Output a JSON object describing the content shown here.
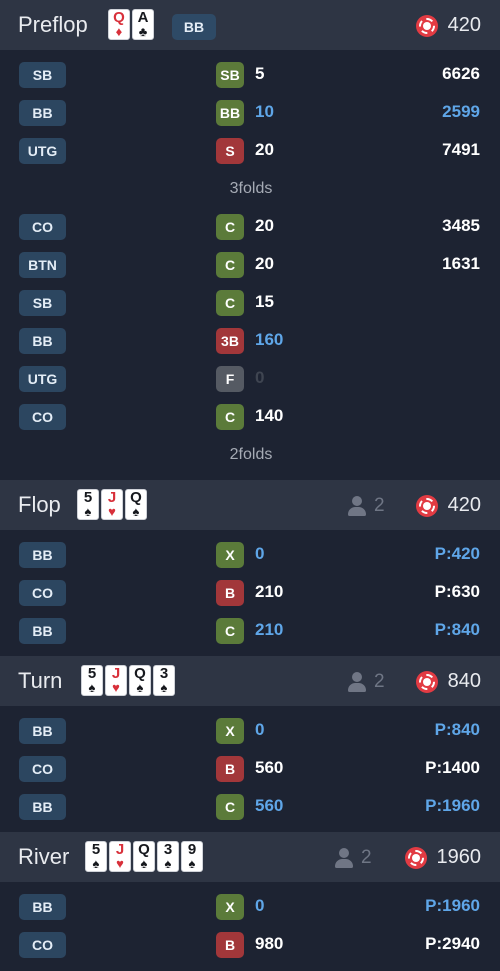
{
  "colors": {
    "background": "#1d2332",
    "header": "#2e3544",
    "position_badge": "#2c4660",
    "call": "#5b7b3a",
    "raise": "#a2373a",
    "fold": "#555a63",
    "hero_text": "#5fa6e8"
  },
  "icons": {
    "players": "person-icon",
    "pot": "chip-icon"
  },
  "preflop": {
    "name": "Preflop",
    "hole_cards": [
      {
        "rank": "Q",
        "suit": "♦",
        "color": "red"
      },
      {
        "rank": "A",
        "suit": "♣",
        "color": "black"
      }
    ],
    "hero_position": "BB",
    "pot": "420",
    "rows": [
      {
        "pos": "SB",
        "action": "SB",
        "amount": "5",
        "stack": "6626"
      },
      {
        "pos": "BB",
        "action": "BB",
        "amount": "10",
        "stack": "2599"
      },
      {
        "pos": "UTG",
        "action": "S",
        "amount": "20",
        "stack": "7491"
      },
      {
        "folds": "3folds"
      },
      {
        "pos": "CO",
        "action": "C",
        "amount": "20",
        "stack": "3485"
      },
      {
        "pos": "BTN",
        "action": "C",
        "amount": "20",
        "stack": "1631"
      },
      {
        "pos": "SB",
        "action": "C",
        "amount": "15",
        "stack": ""
      },
      {
        "pos": "BB",
        "action": "3B",
        "amount": "160",
        "stack": ""
      },
      {
        "pos": "UTG",
        "action": "F",
        "amount": "0",
        "stack": ""
      },
      {
        "pos": "CO",
        "action": "C",
        "amount": "140",
        "stack": ""
      },
      {
        "folds": "2folds"
      }
    ]
  },
  "flop": {
    "name": "Flop",
    "board": [
      {
        "rank": "5",
        "suit": "♠",
        "color": "black"
      },
      {
        "rank": "J",
        "suit": "♥",
        "color": "red"
      },
      {
        "rank": "Q",
        "suit": "♠",
        "color": "black"
      }
    ],
    "players": "2",
    "pot": "420",
    "rows": [
      {
        "pos": "BB",
        "action": "X",
        "amount": "0",
        "stack": "P:420"
      },
      {
        "pos": "CO",
        "action": "B",
        "amount": "210",
        "stack": "P:630"
      },
      {
        "pos": "BB",
        "action": "C",
        "amount": "210",
        "stack": "P:840"
      }
    ]
  },
  "turn": {
    "name": "Turn",
    "board": [
      {
        "rank": "5",
        "suit": "♠",
        "color": "black"
      },
      {
        "rank": "J",
        "suit": "♥",
        "color": "red"
      },
      {
        "rank": "Q",
        "suit": "♠",
        "color": "black"
      },
      {
        "rank": "3",
        "suit": "♠",
        "color": "black"
      }
    ],
    "players": "2",
    "pot": "840",
    "rows": [
      {
        "pos": "BB",
        "action": "X",
        "amount": "0",
        "stack": "P:840"
      },
      {
        "pos": "CO",
        "action": "B",
        "amount": "560",
        "stack": "P:1400"
      },
      {
        "pos": "BB",
        "action": "C",
        "amount": "560",
        "stack": "P:1960"
      }
    ]
  },
  "river": {
    "name": "River",
    "board": [
      {
        "rank": "5",
        "suit": "♠",
        "color": "black"
      },
      {
        "rank": "J",
        "suit": "♥",
        "color": "red"
      },
      {
        "rank": "Q",
        "suit": "♠",
        "color": "black"
      },
      {
        "rank": "3",
        "suit": "♠",
        "color": "black"
      },
      {
        "rank": "9",
        "suit": "♠",
        "color": "black"
      }
    ],
    "players": "2",
    "pot": "1960",
    "rows": [
      {
        "pos": "BB",
        "action": "X",
        "amount": "0",
        "stack": "P:1960"
      },
      {
        "pos": "CO",
        "action": "B",
        "amount": "980",
        "stack": "P:2940"
      }
    ]
  }
}
